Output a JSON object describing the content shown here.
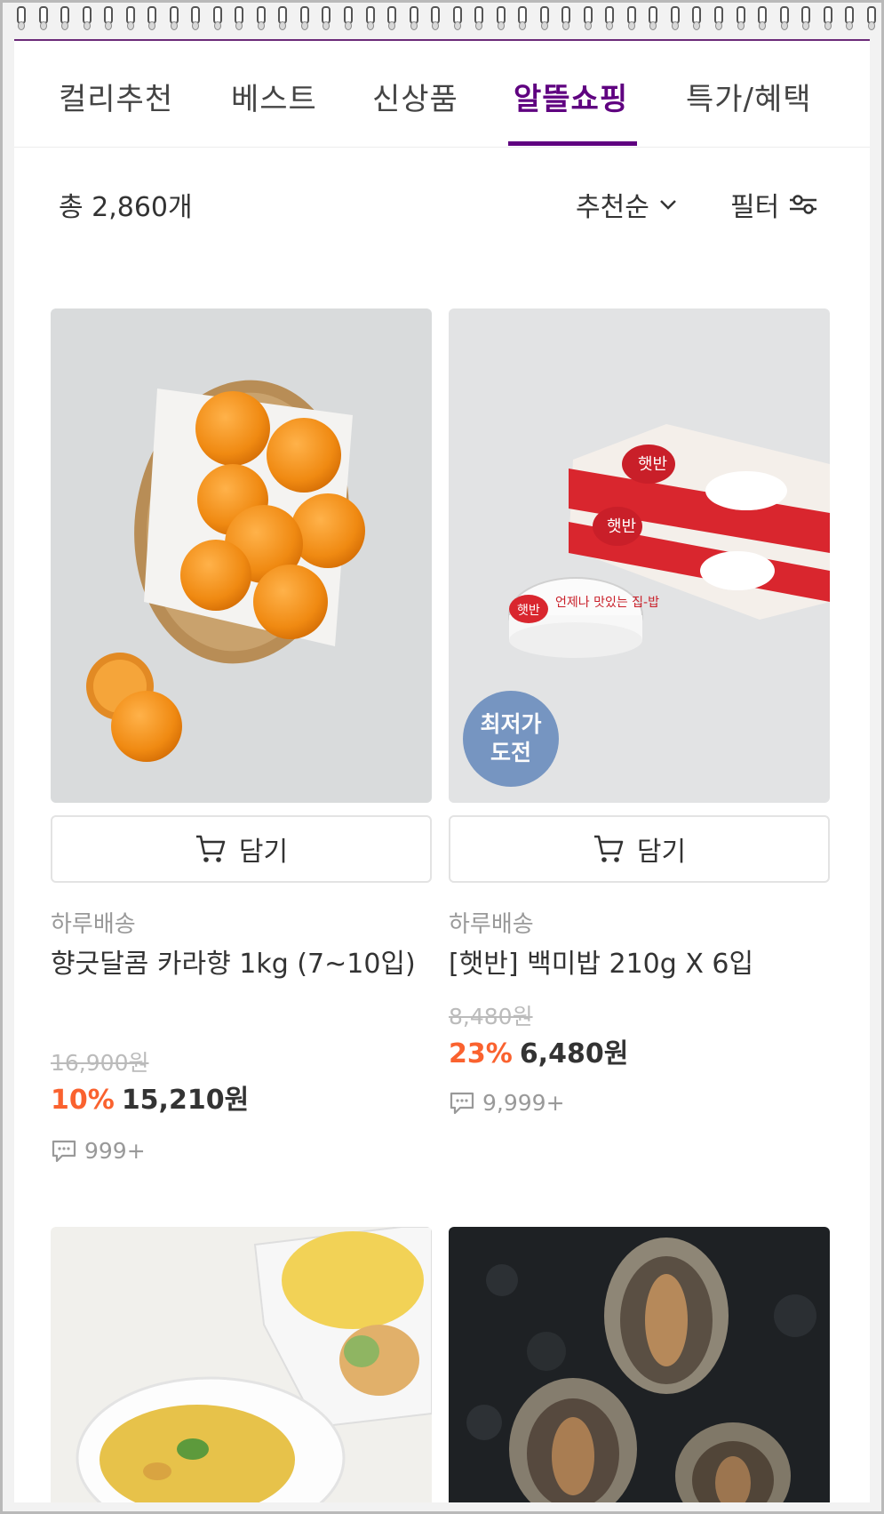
{
  "tabs": [
    {
      "label": "컬리추천"
    },
    {
      "label": "베스트"
    },
    {
      "label": "신상품"
    },
    {
      "label": "알뜰쇼핑"
    },
    {
      "label": "특가/혜택"
    }
  ],
  "active_tab": "알뜰쇼핑",
  "toolbar": {
    "total": "총 2,860개",
    "sort_label": "추천순",
    "filter_label": "필터"
  },
  "products": [
    {
      "cart_label": "담기",
      "delivery": "하루배송",
      "name": "향긋달콤 카라향 1kg (7~10입)",
      "original_price": "16,900원",
      "discount_rate": "10%",
      "price": "15,210원",
      "review_count": "999+"
    },
    {
      "cart_label": "담기",
      "delivery": "하루배송",
      "name": "[햇반] 백미밥 210g X 6입",
      "original_price": "8,480원",
      "discount_rate": "23%",
      "price": "6,480원",
      "review_count": "9,999+",
      "badge_line1": "최저가",
      "badge_line2": "도전",
      "package_brand": "햇반",
      "package_text": "언제나 맛있는 집-밥"
    },
    {},
    {}
  ],
  "colors": {
    "accent": "#5f0080",
    "discount": "#fa622f"
  }
}
